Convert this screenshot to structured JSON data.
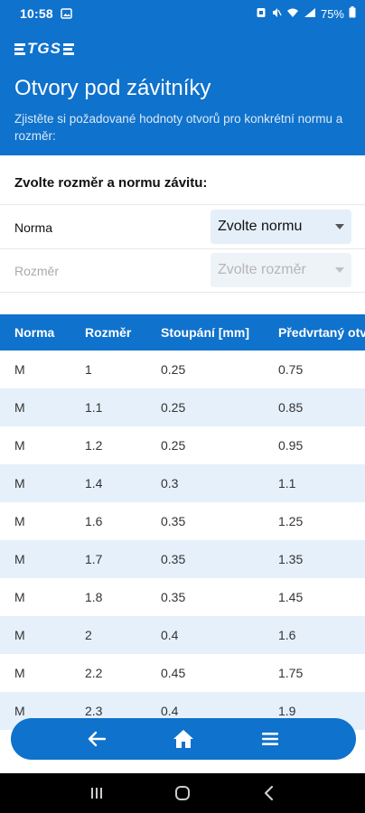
{
  "status_bar": {
    "time": "10:58",
    "battery": "75%",
    "icons": [
      "photo-icon",
      "sim-icon",
      "mute-icon",
      "wifi-icon",
      "signal-icon",
      "battery-icon"
    ]
  },
  "header": {
    "logo": "TGS",
    "title": "Otvory pod závitníky",
    "subtitle": "Zjistěte si požadované hodnoty otvorů pro konkrétní normu a rozměr:"
  },
  "form": {
    "heading": "Zvolte rozměr a normu závitu:",
    "norma_label": "Norma",
    "norma_value": "Zvolte normu",
    "rozmer_label": "Rozměr",
    "rozmer_value": "Zvolte rozměr"
  },
  "table": {
    "headers": [
      "Norma",
      "Rozměr",
      "Stoupání [mm]",
      "Předvrtaný otvor"
    ],
    "rows": [
      [
        "M",
        "1",
        "0.25",
        "0.75"
      ],
      [
        "M",
        "1.1",
        "0.25",
        "0.85"
      ],
      [
        "M",
        "1.2",
        "0.25",
        "0.95"
      ],
      [
        "M",
        "1.4",
        "0.3",
        "1.1"
      ],
      [
        "M",
        "1.6",
        "0.35",
        "1.25"
      ],
      [
        "M",
        "1.7",
        "0.35",
        "1.35"
      ],
      [
        "M",
        "1.8",
        "0.35",
        "1.45"
      ],
      [
        "M",
        "2",
        "0.4",
        "1.6"
      ],
      [
        "M",
        "2.2",
        "0.45",
        "1.75"
      ],
      [
        "M",
        "2.3",
        "0.4",
        "1.9"
      ]
    ]
  },
  "bottom_nav": {
    "items": [
      "back-arrow-icon",
      "home-icon",
      "menu-icon"
    ]
  },
  "colors": {
    "primary": "#0f72cc",
    "row_alt": "#e5f0fb",
    "select_bg": "#e5eff9"
  }
}
